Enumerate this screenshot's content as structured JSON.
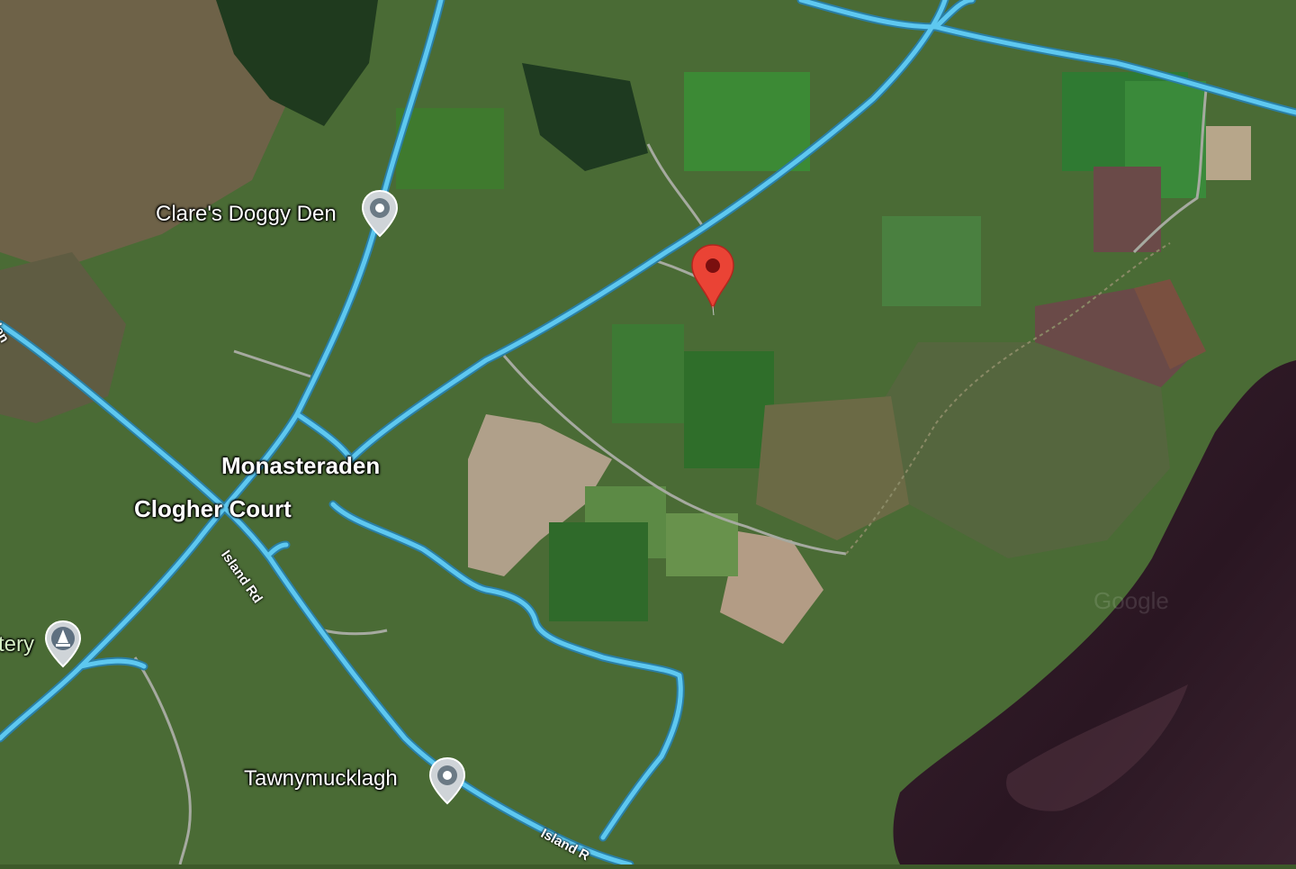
{
  "map": {
    "places": {
      "claresDoggyDen": "Clare's Doggy Den",
      "monasteraden": "Monasteraden",
      "clogherCourt": "Clogher Court",
      "tawnymucklagh": "Tawnymucklagh",
      "cemetery": "tery",
      "leftRoad": "den"
    },
    "roads": {
      "islandRd1": "Island Rd",
      "islandRd2": "Island R"
    },
    "watermark": "Google",
    "icons": {
      "place": "place-pin-icon",
      "cemetery": "cemetery-pin-icon",
      "selected": "selected-location-pin-icon"
    },
    "colors": {
      "road": "#5ec8f0",
      "selectedPin": "#ea4335",
      "lake": "#2a1622"
    }
  }
}
